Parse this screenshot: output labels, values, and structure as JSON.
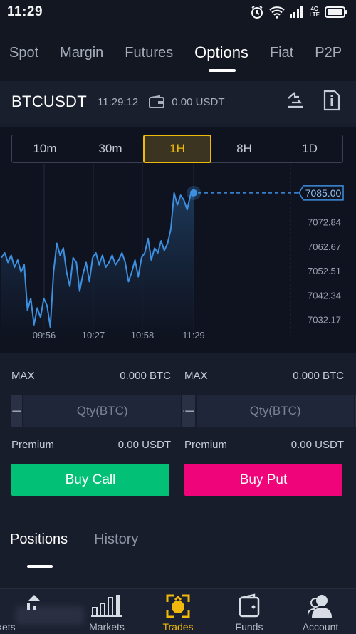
{
  "status_bar": {
    "time": "11:29",
    "network_top": "4G",
    "network_bottom": "LTE"
  },
  "top_tabs": [
    {
      "label": "Spot",
      "active": false
    },
    {
      "label": "Margin",
      "active": false
    },
    {
      "label": "Futures",
      "active": false
    },
    {
      "label": "Options",
      "active": true
    },
    {
      "label": "Fiat",
      "active": false
    },
    {
      "label": "P2P",
      "active": false
    }
  ],
  "pair": {
    "name": "BTCUSDT",
    "time": "11:29:12",
    "balance": "0.00 USDT"
  },
  "intervals": [
    {
      "label": "10m",
      "active": false
    },
    {
      "label": "30m",
      "active": false
    },
    {
      "label": "1H",
      "active": true
    },
    {
      "label": "8H",
      "active": false
    },
    {
      "label": "1D",
      "active": false
    }
  ],
  "chart_data": {
    "type": "area",
    "current_price": "7085.00",
    "x_ticks": [
      "09:56",
      "10:27",
      "10:58",
      "11:29"
    ],
    "y_ticks": [
      "7072.84",
      "7062.67",
      "7052.51",
      "7042.34",
      "7032.17"
    ],
    "ylim": [
      7027,
      7090
    ],
    "x": [
      0,
      1,
      2,
      3,
      4,
      5,
      6,
      7,
      8,
      9,
      10,
      11,
      12,
      13,
      14,
      15,
      16,
      17,
      18,
      19,
      20,
      21,
      22,
      23,
      24,
      25,
      26,
      27,
      28,
      29,
      30,
      31,
      32,
      33,
      34,
      35,
      36,
      37,
      38,
      39,
      40,
      41,
      42,
      43,
      44,
      45,
      46,
      47,
      48,
      49,
      50,
      51,
      52,
      53,
      54,
      55,
      56,
      57,
      58,
      59
    ],
    "values": [
      7058,
      7060,
      7056,
      7059,
      7054,
      7057,
      7052,
      7055,
      7036,
      7041,
      7030,
      7037,
      7033,
      7041,
      7038,
      7029,
      7052,
      7064,
      7059,
      7062,
      7052,
      7046,
      7058,
      7056,
      7044,
      7051,
      7056,
      7048,
      7058,
      7060,
      7055,
      7059,
      7054,
      7056,
      7059,
      7055,
      7057,
      7060,
      7056,
      7048,
      7052,
      7057,
      7050,
      7058,
      7060,
      7066,
      7057,
      7062,
      7060,
      7065,
      7061,
      7064,
      7070,
      7085,
      7080,
      7084,
      7082,
      7078,
      7084,
      7085
    ],
    "grid": true,
    "colors": {
      "line": "#3d8fe0",
      "fill": "#1d3a5c",
      "price_tag": "#3d8fe0"
    }
  },
  "orders": {
    "call": {
      "max_label": "MAX",
      "max_value": "0.000 BTC",
      "qty_placeholder": "Qty(BTC)",
      "premium_label": "Premium",
      "premium_value": "0.00 USDT",
      "button": "Buy Call"
    },
    "put": {
      "max_label": "MAX",
      "max_value": "0.000 BTC",
      "qty_placeholder": "Qty(BTC)",
      "premium_label": "Premium",
      "premium_value": "0.00 USDT",
      "button": "Buy Put"
    },
    "colors": {
      "call": "#02c076",
      "put": "#f0047a"
    }
  },
  "positions_tabs": [
    {
      "label": "Positions",
      "active": true
    },
    {
      "label": "History",
      "active": false
    }
  ],
  "bottom_nav": [
    {
      "label": "kets",
      "icon": "markets-icon"
    },
    {
      "label": "Markets",
      "icon": "bar-chart-icon"
    },
    {
      "label": "Trades",
      "icon": "trades-icon",
      "active": true
    },
    {
      "label": "Funds",
      "icon": "wallet-icon"
    },
    {
      "label": "Account",
      "icon": "user-icon"
    }
  ]
}
